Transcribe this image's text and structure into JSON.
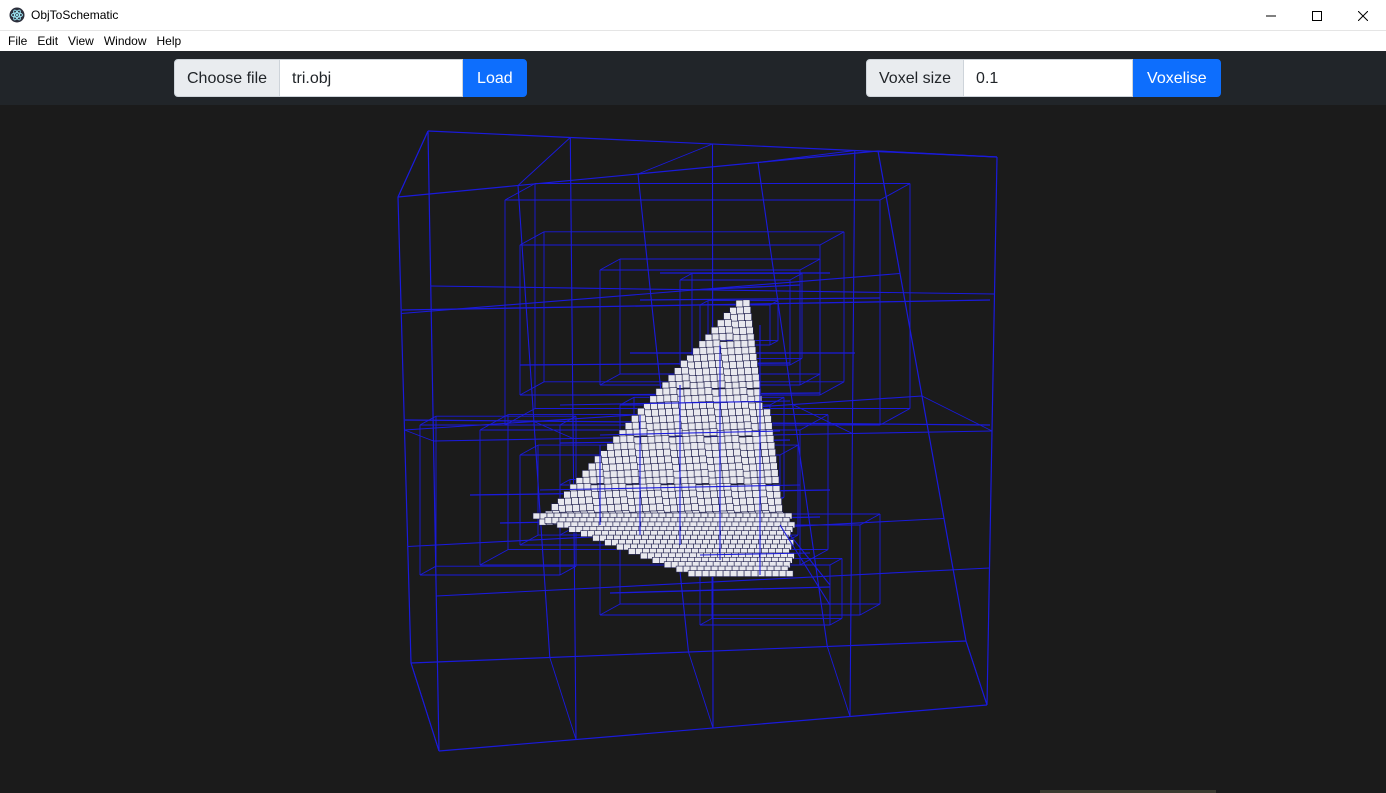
{
  "window": {
    "title": "ObjToSchematic",
    "icon": "electron-atom-icon",
    "controls": [
      "minimize-icon",
      "maximize-icon",
      "close-icon"
    ]
  },
  "menu": {
    "items": [
      "File",
      "Edit",
      "View",
      "Window",
      "Help"
    ]
  },
  "toolbar": {
    "file": {
      "choose_label": "Choose file",
      "value": "tri.obj",
      "load_label": "Load"
    },
    "voxel": {
      "size_label": "Voxel size",
      "value": "0.1",
      "voxelise_label": "Voxelise"
    }
  },
  "viewport": {
    "background": "#1b1b1b",
    "wireframe_color": "#1a1adc",
    "voxel_color": "#e8e8ee",
    "content": "voxelised triangle inside octree wireframe"
  },
  "colors": {
    "accent": "#0d6efd",
    "toolbar_bg": "#212529"
  }
}
